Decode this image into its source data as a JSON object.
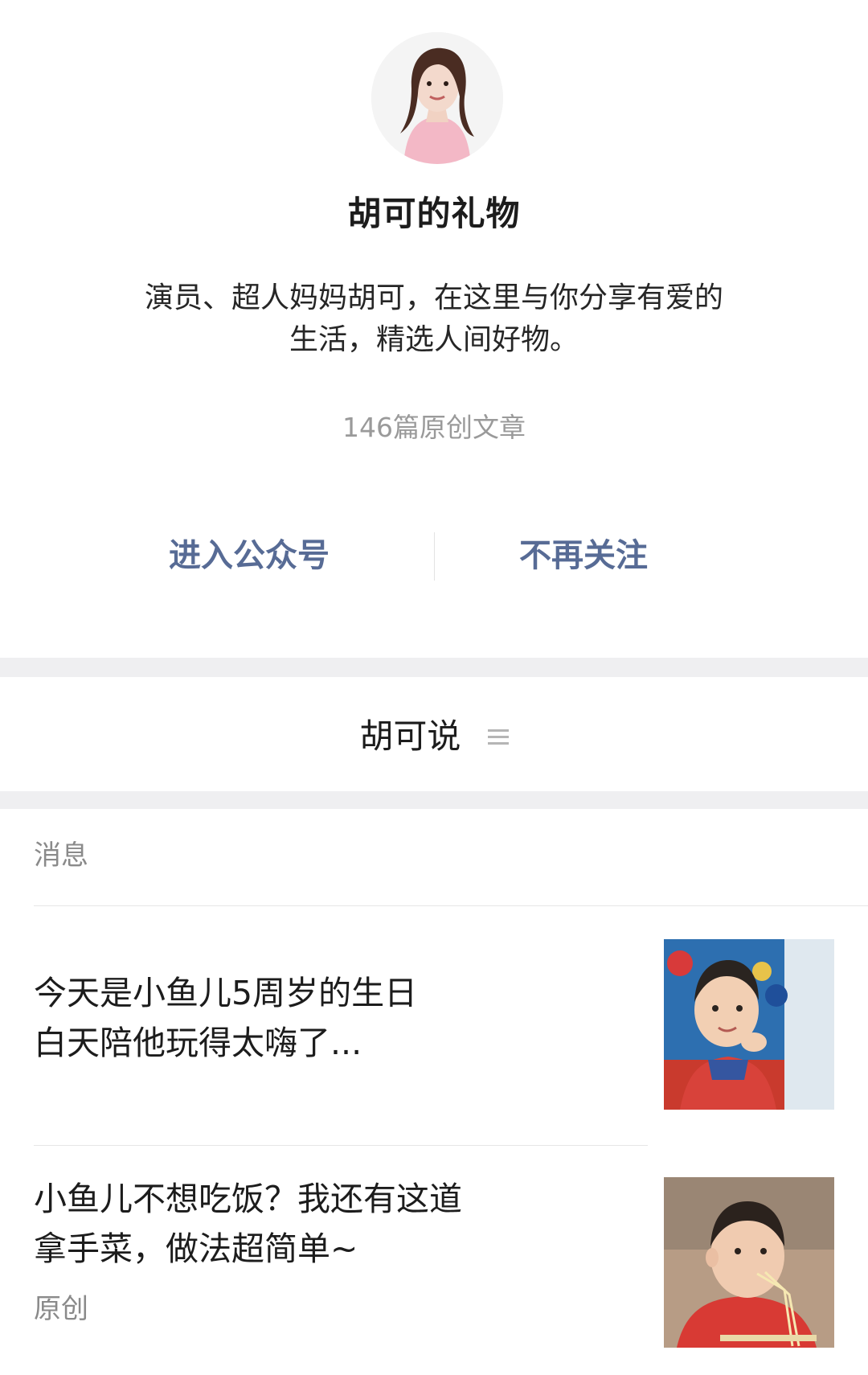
{
  "profile": {
    "name": "胡可的礼物",
    "bio": "演员、超人妈妈胡可，在这里与你分享有爱的\n生活，精选人间好物。",
    "article_count": "146篇原创文章",
    "enter_label": "进入公众号",
    "unfollow_label": "不再关注",
    "avatar_icon": "user-avatar-photo"
  },
  "menu": {
    "label": "胡可说",
    "icon": "menu-lines-icon"
  },
  "messages": {
    "section_label": "消息",
    "items": [
      {
        "title": "今天是小鱼儿5周岁的生日\n白天陪他玩得太嗨了...",
        "tag": "",
        "thumb_icon": "child-photo-thumbnail"
      },
      {
        "title": "小鱼儿不想吃饭？我还有这道\n拿手菜，做法超简单~",
        "tag": "原创",
        "thumb_icon": "child-eating-photo-thumbnail"
      }
    ]
  },
  "colors": {
    "link": "#576b95",
    "muted": "#9a9a9a",
    "divider_band": "#efeff1"
  }
}
